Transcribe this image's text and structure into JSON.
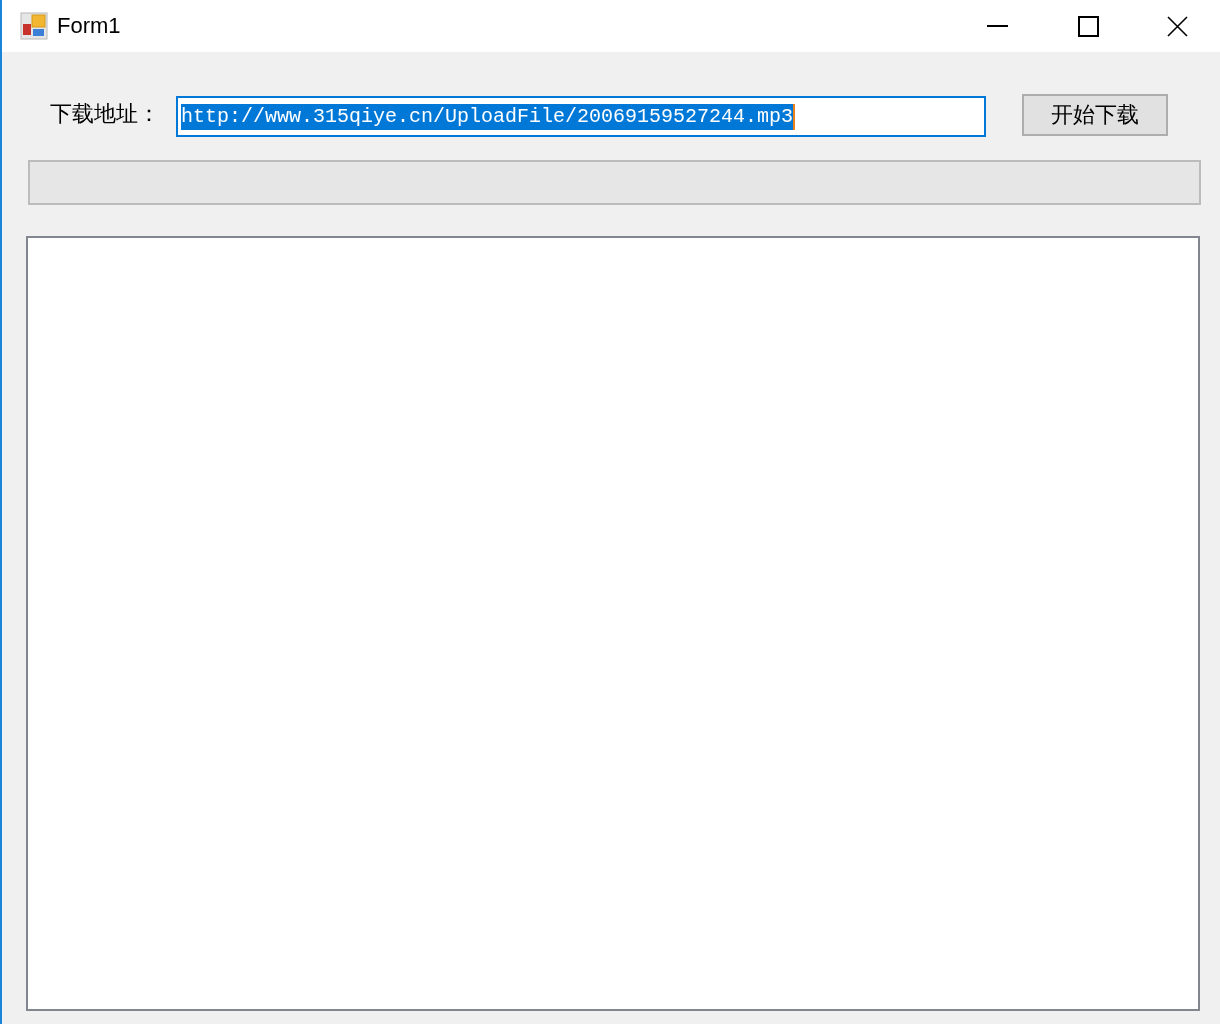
{
  "window": {
    "title": "Form1"
  },
  "form": {
    "url_label": "下载地址：",
    "url_field": {
      "value": "http://www.315qiye.cn/UploadFile/20069159527244.mp3",
      "focused": true,
      "text_selected": true
    },
    "download_button": {
      "label": "开始下载"
    },
    "progress": {
      "level": 0
    }
  }
}
